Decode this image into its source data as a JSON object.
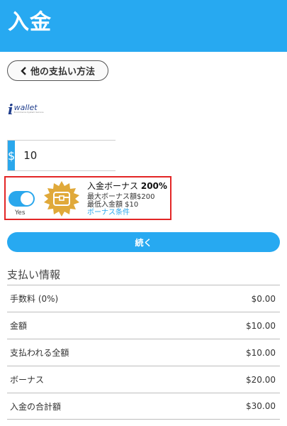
{
  "header": {
    "title": "入金"
  },
  "back_button": {
    "label": "他の支払い方法",
    "icon": "chevron-left-icon"
  },
  "payment_method": {
    "logo_text": "wallet",
    "logo_sub": "Ecommerce System Service"
  },
  "amount": {
    "currency": "$",
    "value": "10"
  },
  "bonus": {
    "toggle_label": "Yes",
    "toggle_on": true,
    "title_prefix": "入金ボーナス",
    "title_percent": "200%",
    "max_bonus": "最大ボーナス額$200",
    "min_deposit": "最低入金額 $10",
    "terms_link": "ボーナス条件",
    "icon": "treasure-chest-icon"
  },
  "continue_button": {
    "label": "続く"
  },
  "payment_info": {
    "title": "支払い情報",
    "rows": [
      {
        "label": "手数料 (0%)",
        "value": "$0.00"
      },
      {
        "label": "金額",
        "value": "$10.00"
      },
      {
        "label": "支払われる全額",
        "value": "$10.00"
      },
      {
        "label": "ボーナス",
        "value": "$20.00"
      },
      {
        "label": "入金の合計額",
        "value": "$30.00"
      }
    ]
  },
  "colors": {
    "accent": "#27a9f1",
    "highlight_border": "#e32626",
    "badge_gold": "#e0a93a"
  }
}
